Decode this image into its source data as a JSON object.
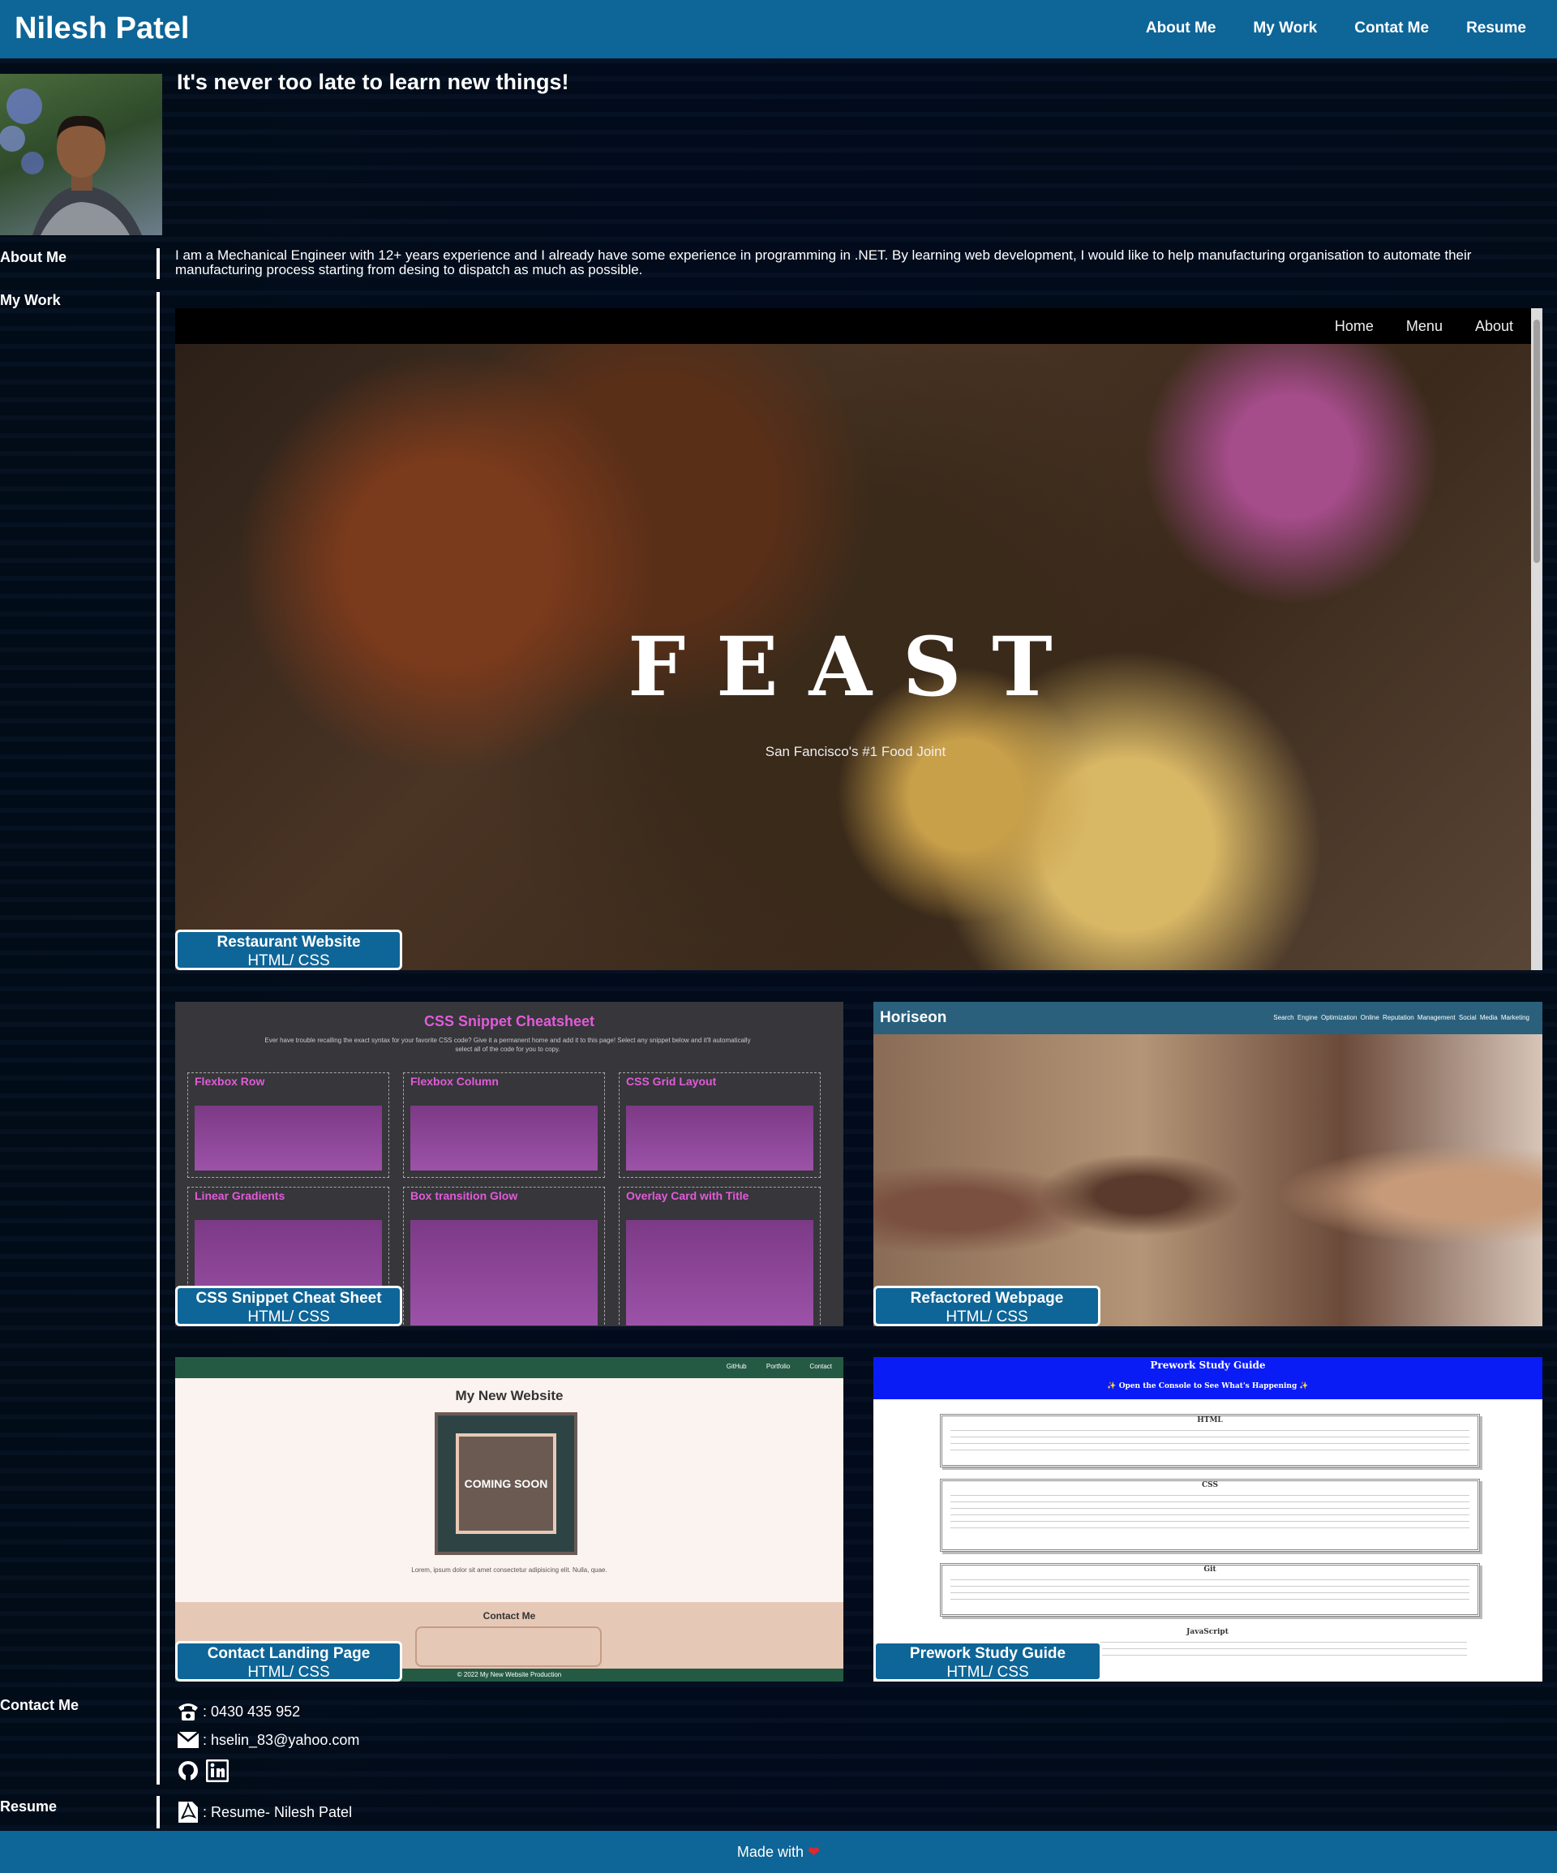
{
  "header": {
    "site_title": "Nilesh Patel",
    "nav": [
      "About Me",
      "My Work",
      "Contat Me",
      "Resume"
    ]
  },
  "hero": {
    "tagline": "It's never too late to learn new things!"
  },
  "about": {
    "label": "About Me",
    "text": "I am a Mechanical Engineer with 12+ years experience and I already have some experience in programming in .NET. By learning web development, I would like to help manufacturing organisation to automate their manufacturing process starting from desing to dispatch as much as possible."
  },
  "work": {
    "label": "My Work",
    "projects": [
      {
        "title": "Restaurant Website",
        "tech": "HTML/ CSS"
      },
      {
        "title": "CSS Snippet Cheat Sheet",
        "tech": "HTML/ CSS"
      },
      {
        "title": "Refactored Webpage",
        "tech": "HTML/ CSS"
      },
      {
        "title": "Contact Landing Page",
        "tech": "HTML/ CSS"
      },
      {
        "title": "Prework Study Guide",
        "tech": "HTML/ CSS"
      }
    ],
    "feast": {
      "nav": [
        "Home",
        "Menu",
        "About"
      ],
      "title": "FEAST",
      "subtitle": "San Fancisco's #1 Food Joint"
    },
    "cheatsheet": {
      "title": "CSS Snippet Cheatsheet",
      "note": "Ever have trouble recalling the exact syntax for your favorite CSS code? Give it a permanent home and add it to this page! Select any snippet below and it'll automatically select all of the code for you to copy.",
      "snippets": [
        "Flexbox Row",
        "Flexbox Column",
        "CSS Grid Layout",
        "Linear Gradients",
        "Box transition Glow",
        "Overlay Card with Title"
      ]
    },
    "horiseon": {
      "brand": "Horiseon",
      "links": "Search Engine Optimization   Online Reputation Management   Social Media Marketing"
    },
    "landing": {
      "nav": "GitHub Portfolio Contact",
      "title": "My New Website",
      "badge": "COMING SOON",
      "lorem": "Lorem, ipsum dolor sit amet consectetur adipisicing elit. Nulla, quae.",
      "contact": "Contact Me",
      "footer": "© 2022 My New Website Production"
    },
    "prework": {
      "title": "Prework Study Guide",
      "subtitle": "✨ Open the Console to See What's Happening ✨",
      "sections": [
        "HTML",
        "CSS",
        "Git",
        "JavaScript"
      ]
    }
  },
  "contact": {
    "label": "Contact Me",
    "phone": ": 0430 435 952",
    "email": ": hselin_83@yahoo.com"
  },
  "resume": {
    "label": "Resume",
    "link": ": Resume- Nilesh Patel"
  },
  "footer": {
    "text": "Made with",
    "heart": "❤"
  }
}
